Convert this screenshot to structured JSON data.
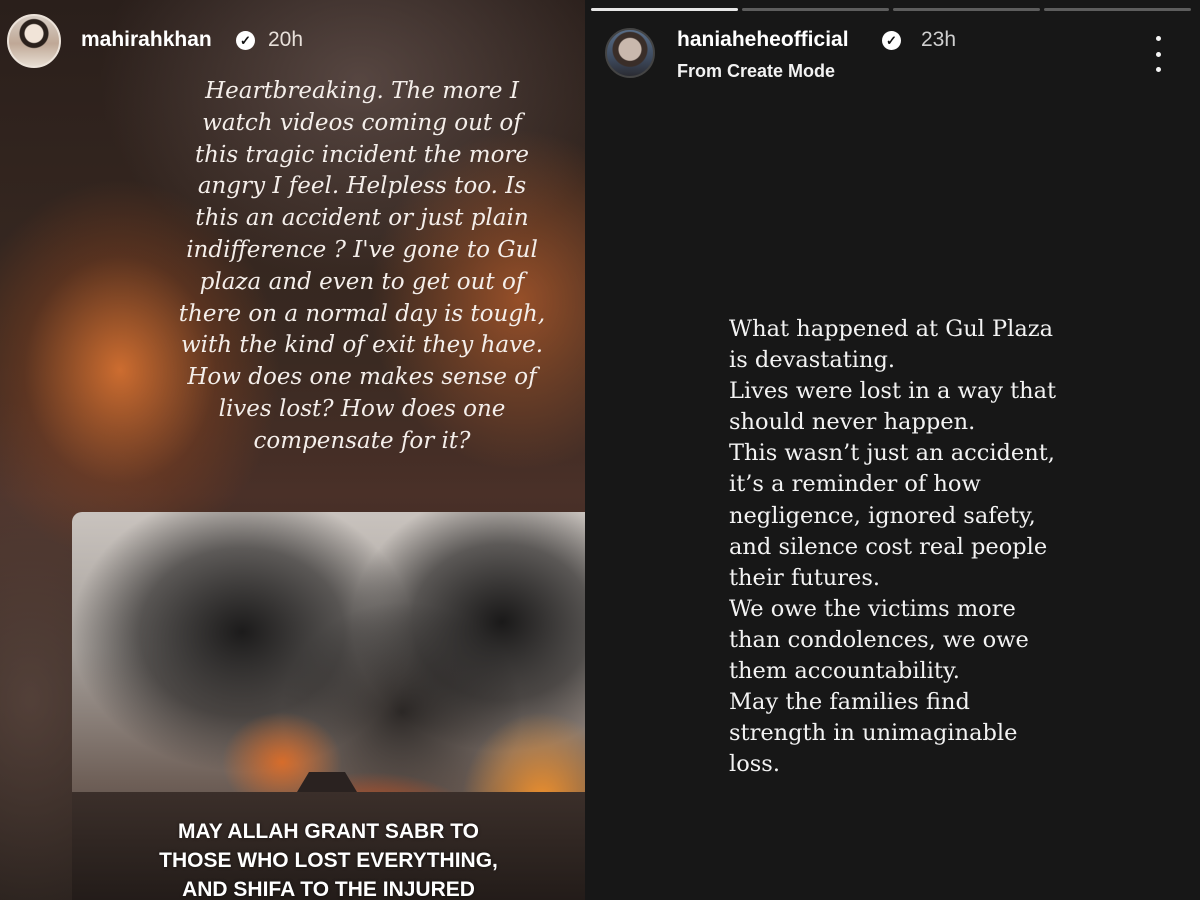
{
  "left_story": {
    "username": "mahirahkhan",
    "verified_icon": "verified-badge-icon",
    "time": "20h",
    "text": "Heartbreaking. The more I watch videos coming out of this tragic incident the more angry I feel. Helpless too. Is this an accident or just plain indifference ? I've gone to Gul plaza and even to get out of there on a normal day is tough, with the kind of exit they have. How does one makes sense of lives lost? How does one compensate for it?",
    "image_caption": [
      "MAY ALLAH GRANT SABR TO",
      "THOSE WHO LOST EVERYTHING,",
      "AND SHIFA TO THE INJURED"
    ]
  },
  "right_story": {
    "username": "haniaheheofficial",
    "verified_icon": "verified-badge-icon",
    "time": "23h",
    "subtitle": "From Create Mode",
    "progress_segments": 4,
    "active_segment": 1,
    "lines": [
      "What happened at Gul Plaza",
      "is devastating.",
      "Lives were lost in a way that",
      "should never happen.",
      "This wasn’t just an accident,",
      "it’s a reminder of how",
      "negligence, ignored safety,",
      "and silence cost real people",
      "their futures.",
      "We owe the victims more",
      "than condolences, we owe",
      "them accountability.",
      "May the families find",
      "strength in unimaginable",
      "loss."
    ]
  },
  "colors": {
    "right_background": "#171717",
    "text": "#ffffff"
  }
}
